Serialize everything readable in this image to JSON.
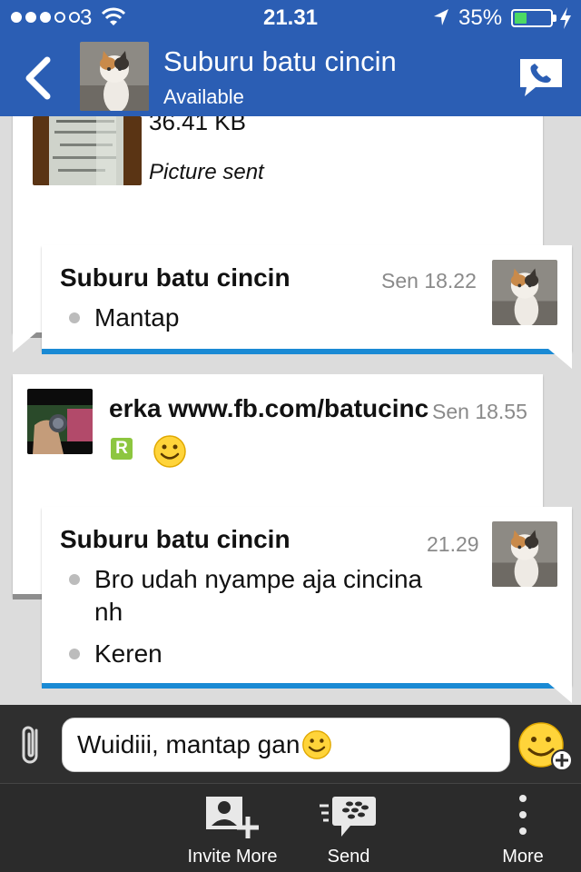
{
  "status_bar": {
    "carrier": "3",
    "time": "21.31",
    "battery_pct": "35%",
    "battery_level": 0.35,
    "signal_filled": 3,
    "signal_total": 5
  },
  "header": {
    "title": "Suburu batu cincin",
    "status": "Available"
  },
  "messages": {
    "m0": {
      "size": "36.41 KB",
      "note": "Picture sent"
    },
    "m1": {
      "sender": "Suburu batu cincin",
      "time": "Sen 18.22",
      "lines": [
        "Mantap"
      ]
    },
    "m2": {
      "sender": "erka www.fb.com/batucincin",
      "time": "Sen 18.55",
      "badge": "R"
    },
    "m3": {
      "sender": "Suburu batu cincin",
      "time": "21.29",
      "lines": [
        "Bro udah nyampe aja cincina",
        "nh",
        "Keren"
      ]
    }
  },
  "composer": {
    "text": "Wuidiii, mantap gan"
  },
  "toolbar": {
    "invite": "Invite More",
    "send": "Send",
    "more": "More"
  },
  "colors": {
    "header_bg": "#2b5eb4",
    "accent_blue": "#1a8ad4",
    "battery_green": "#4cd964"
  },
  "icons": [
    "back-chevron-icon",
    "phone-icon",
    "paperclip-icon",
    "smiley-icon",
    "invite-contact-icon",
    "bbm-send-icon",
    "more-dots-icon"
  ]
}
